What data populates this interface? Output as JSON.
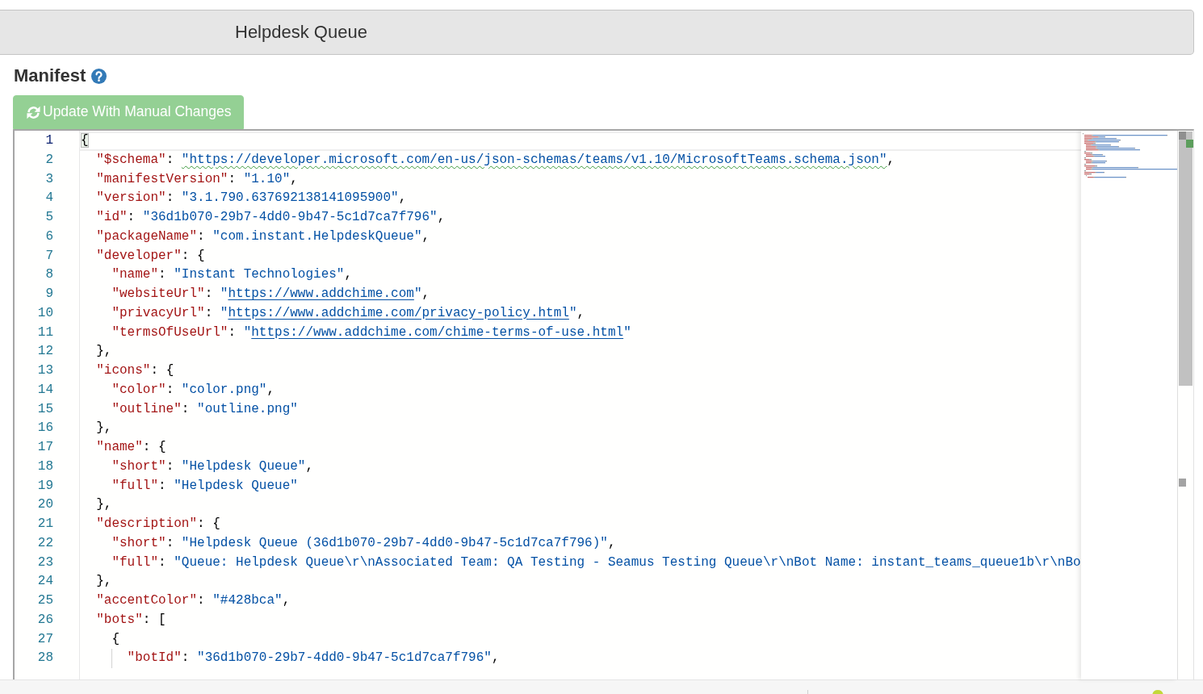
{
  "header": {
    "title": "Helpdesk Queue"
  },
  "manifest": {
    "heading": "Manifest",
    "update_button": {
      "label": "Update With Manual Changes",
      "disabled": true
    }
  },
  "editor": {
    "lines": [
      {
        "number": "1",
        "current": true,
        "tokens": [
          {
            "kind": "brace-match",
            "text": "{"
          }
        ],
        "children": [
          {
            "number": "2",
            "current": false,
            "tokens": [
              {
                "kind": "key",
                "text": "\"$schema\""
              },
              {
                "kind": "punct",
                "text": ": "
              },
              {
                "kind": "flagged",
                "text": "\"https://developer.microsoft.com/en-us/json-schemas/teams/v1.10/MicrosoftTeams.schema.json\""
              },
              {
                "kind": "punct",
                "text": ","
              }
            ]
          },
          {
            "number": "3",
            "current": false,
            "tokens": [
              {
                "kind": "key",
                "text": "\"manifestVersion\""
              },
              {
                "kind": "punct",
                "text": ": "
              },
              {
                "kind": "string",
                "text": "\"1.10\""
              },
              {
                "kind": "punct",
                "text": ","
              }
            ]
          },
          {
            "number": "4",
            "current": false,
            "tokens": [
              {
                "kind": "key",
                "text": "\"version\""
              },
              {
                "kind": "punct",
                "text": ": "
              },
              {
                "kind": "string",
                "text": "\"3.1.790.637692138141095900\""
              },
              {
                "kind": "punct",
                "text": ","
              }
            ]
          },
          {
            "number": "5",
            "current": false,
            "tokens": [
              {
                "kind": "key",
                "text": "\"id\""
              },
              {
                "kind": "punct",
                "text": ": "
              },
              {
                "kind": "string",
                "text": "\"36d1b070-29b7-4dd0-9b47-5c1d7ca7f796\""
              },
              {
                "kind": "punct",
                "text": ","
              }
            ]
          },
          {
            "number": "6",
            "current": false,
            "tokens": [
              {
                "kind": "key",
                "text": "\"packageName\""
              },
              {
                "kind": "punct",
                "text": ": "
              },
              {
                "kind": "string",
                "text": "\"com.instant.HelpdeskQueue\""
              },
              {
                "kind": "punct",
                "text": ","
              }
            ]
          },
          {
            "number": "7",
            "current": false,
            "tokens": [
              {
                "kind": "key",
                "text": "\"developer\""
              },
              {
                "kind": "punct",
                "text": ": {"
              }
            ],
            "children": [
              {
                "number": "8",
                "current": false,
                "tokens": [
                  {
                    "kind": "key",
                    "text": "\"name\""
                  },
                  {
                    "kind": "punct",
                    "text": ": "
                  },
                  {
                    "kind": "string",
                    "text": "\"Instant Technologies\""
                  },
                  {
                    "kind": "punct",
                    "text": ","
                  }
                ]
              },
              {
                "number": "9",
                "current": false,
                "tokens": [
                  {
                    "kind": "key",
                    "text": "\"websiteUrl\""
                  },
                  {
                    "kind": "punct",
                    "text": ": "
                  },
                  {
                    "kind": "string",
                    "text": "\""
                  },
                  {
                    "kind": "link",
                    "text": "https://www.addchime.com"
                  },
                  {
                    "kind": "string",
                    "text": "\""
                  },
                  {
                    "kind": "punct",
                    "text": ","
                  }
                ]
              },
              {
                "number": "10",
                "current": false,
                "tokens": [
                  {
                    "kind": "key",
                    "text": "\"privacyUrl\""
                  },
                  {
                    "kind": "punct",
                    "text": ": "
                  },
                  {
                    "kind": "string",
                    "text": "\""
                  },
                  {
                    "kind": "link",
                    "text": "https://www.addchime.com/privacy-policy.html"
                  },
                  {
                    "kind": "string",
                    "text": "\""
                  },
                  {
                    "kind": "punct",
                    "text": ","
                  }
                ]
              },
              {
                "number": "11",
                "current": false,
                "tokens": [
                  {
                    "kind": "key",
                    "text": "\"termsOfUseUrl\""
                  },
                  {
                    "kind": "punct",
                    "text": ": "
                  },
                  {
                    "kind": "string",
                    "text": "\""
                  },
                  {
                    "kind": "link",
                    "text": "https://www.addchime.com/chime-terms-of-use.html"
                  },
                  {
                    "kind": "string",
                    "text": "\""
                  }
                ]
              }
            ]
          },
          {
            "number": "12",
            "current": false,
            "tokens": [
              {
                "kind": "punct",
                "text": "},"
              }
            ]
          },
          {
            "number": "13",
            "current": false,
            "tokens": [
              {
                "kind": "key",
                "text": "\"icons\""
              },
              {
                "kind": "punct",
                "text": ": {"
              }
            ],
            "children": [
              {
                "number": "14",
                "current": false,
                "tokens": [
                  {
                    "kind": "key",
                    "text": "\"color\""
                  },
                  {
                    "kind": "punct",
                    "text": ": "
                  },
                  {
                    "kind": "string",
                    "text": "\"color.png\""
                  },
                  {
                    "kind": "punct",
                    "text": ","
                  }
                ]
              },
              {
                "number": "15",
                "current": false,
                "tokens": [
                  {
                    "kind": "key",
                    "text": "\"outline\""
                  },
                  {
                    "kind": "punct",
                    "text": ": "
                  },
                  {
                    "kind": "string",
                    "text": "\"outline.png\""
                  }
                ]
              }
            ]
          },
          {
            "number": "16",
            "current": false,
            "tokens": [
              {
                "kind": "punct",
                "text": "},"
              }
            ]
          },
          {
            "number": "17",
            "current": false,
            "tokens": [
              {
                "kind": "key",
                "text": "\"name\""
              },
              {
                "kind": "punct",
                "text": ": {"
              }
            ],
            "children": [
              {
                "number": "18",
                "current": false,
                "tokens": [
                  {
                    "kind": "key",
                    "text": "\"short\""
                  },
                  {
                    "kind": "punct",
                    "text": ": "
                  },
                  {
                    "kind": "string",
                    "text": "\"Helpdesk Queue\""
                  },
                  {
                    "kind": "punct",
                    "text": ","
                  }
                ]
              },
              {
                "number": "19",
                "current": false,
                "tokens": [
                  {
                    "kind": "key",
                    "text": "\"full\""
                  },
                  {
                    "kind": "punct",
                    "text": ": "
                  },
                  {
                    "kind": "string",
                    "text": "\"Helpdesk Queue\""
                  }
                ]
              }
            ]
          },
          {
            "number": "20",
            "current": false,
            "tokens": [
              {
                "kind": "punct",
                "text": "},"
              }
            ]
          },
          {
            "number": "21",
            "current": false,
            "tokens": [
              {
                "kind": "key",
                "text": "\"description\""
              },
              {
                "kind": "punct",
                "text": ": {"
              }
            ],
            "children": [
              {
                "number": "22",
                "current": false,
                "tokens": [
                  {
                    "kind": "key",
                    "text": "\"short\""
                  },
                  {
                    "kind": "punct",
                    "text": ": "
                  },
                  {
                    "kind": "string",
                    "text": "\"Helpdesk Queue (36d1b070-29b7-4dd0-9b47-5c1d7ca7f796)\""
                  },
                  {
                    "kind": "punct",
                    "text": ","
                  }
                ]
              },
              {
                "number": "23",
                "current": false,
                "tokens": [
                  {
                    "kind": "key",
                    "text": "\"full\""
                  },
                  {
                    "kind": "punct",
                    "text": ": "
                  },
                  {
                    "kind": "string",
                    "text": "\"Queue: Helpdesk Queue\\r\\nAssociated Team: QA Testing - Seamus Testing Queue\\r\\nBot Name: instant_teams_queue1b\\r\\nBo"
                  }
                ]
              }
            ]
          },
          {
            "number": "24",
            "current": false,
            "tokens": [
              {
                "kind": "punct",
                "text": "},"
              }
            ]
          },
          {
            "number": "25",
            "current": false,
            "tokens": [
              {
                "kind": "key",
                "text": "\"accentColor\""
              },
              {
                "kind": "punct",
                "text": ": "
              },
              {
                "kind": "string",
                "text": "\"#428bca\""
              },
              {
                "kind": "punct",
                "text": ","
              }
            ]
          },
          {
            "number": "26",
            "current": false,
            "tokens": [
              {
                "kind": "key",
                "text": "\"bots\""
              },
              {
                "kind": "punct",
                "text": ": ["
              }
            ],
            "children": [
              {
                "number": "27",
                "current": false,
                "tokens": [
                  {
                    "kind": "punct",
                    "text": "{"
                  }
                ],
                "children": [
                  {
                    "number": "28",
                    "current": false,
                    "tokens": [
                      {
                        "kind": "key",
                        "text": "\"botId\""
                      },
                      {
                        "kind": "punct",
                        "text": ": "
                      },
                      {
                        "kind": "string",
                        "text": "\"36d1b070-29b7-4dd0-9b47-5c1d7ca7f796\""
                      },
                      {
                        "kind": "punct",
                        "text": ","
                      }
                    ]
                  }
                ]
              }
            ]
          }
        ]
      }
    ]
  }
}
